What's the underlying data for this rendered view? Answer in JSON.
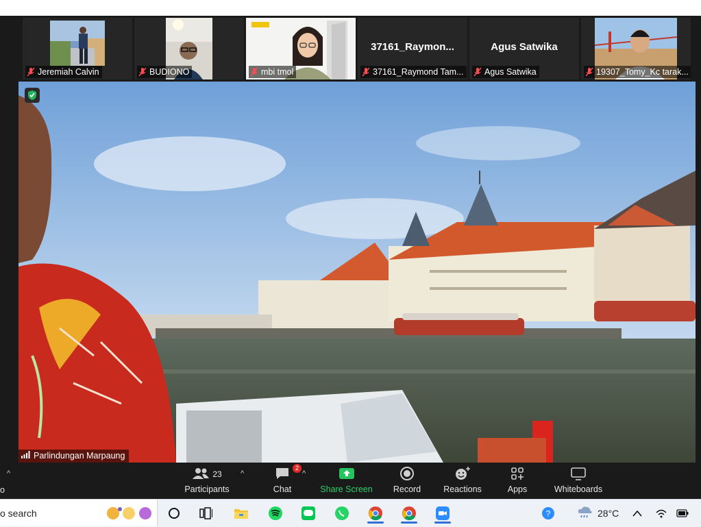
{
  "participants_strip": [
    {
      "name": "Jeremiah Calvin",
      "muted": true,
      "has_video": true
    },
    {
      "name": "BUDIONO",
      "muted": true,
      "has_video": true
    },
    {
      "name": "mbi tmol",
      "muted": true,
      "has_video": true
    },
    {
      "name": "37161_Raymond Tam...",
      "display_name": "37161_Raymon...",
      "muted": true,
      "has_video": false
    },
    {
      "name": "Agus Satwika",
      "display_name": "Agus Satwika",
      "muted": true,
      "has_video": false
    },
    {
      "name": "19307_Tomy_Kc tarak...",
      "muted": true,
      "has_video": true
    }
  ],
  "main_video": {
    "speaker": "Parlindungan Marpaung",
    "encryption_icon": "shield-check-icon"
  },
  "toolbar": {
    "participants_label": "Participants",
    "participants_count": "23",
    "chat_label": "Chat",
    "chat_badge": "2",
    "share_label": "Share Screen",
    "record_label": "Record",
    "reactions_label": "Reactions",
    "apps_label": "Apps",
    "whiteboards_label": "Whiteboards",
    "left_partial": "o",
    "accent_share": "#22c55e"
  },
  "taskbar": {
    "search_text": "o search",
    "apps": [
      "cortana-icon",
      "task-view-icon",
      "file-explorer-icon",
      "spotify-icon",
      "line-icon",
      "whatsapp-icon",
      "chrome-icon",
      "chrome-profile-icon",
      "zoom-icon"
    ],
    "temperature": "28°C",
    "weather_icon": "cloud-rain-icon"
  }
}
